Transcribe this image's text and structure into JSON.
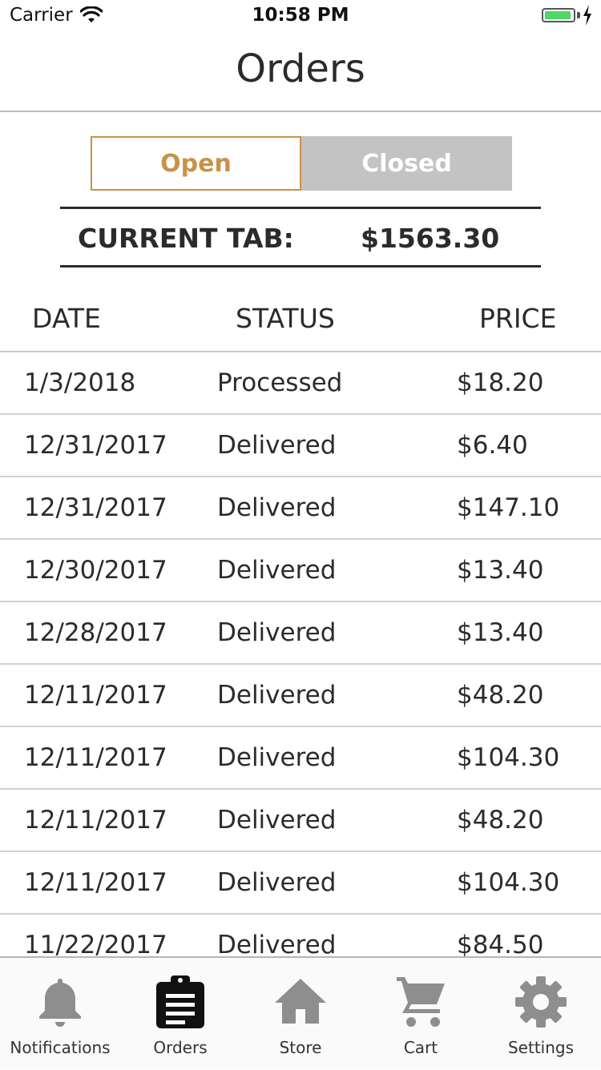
{
  "status_bar": {
    "carrier": "Carrier",
    "time": "10:58 PM",
    "battery_level": 0.95
  },
  "header": {
    "title": "Orders"
  },
  "segments": {
    "open": "Open",
    "closed": "Closed",
    "selected": "Open"
  },
  "current_tab": {
    "label": "CURRENT TAB:",
    "amount": "$1563.30"
  },
  "table": {
    "headers": {
      "date": "DATE",
      "status": "STATUS",
      "price": "PRICE"
    },
    "rows": [
      {
        "date": "1/3/2018",
        "status": "Processed",
        "price": "$18.20"
      },
      {
        "date": "12/31/2017",
        "status": "Delivered",
        "price": "$6.40"
      },
      {
        "date": "12/31/2017",
        "status": "Delivered",
        "price": "$147.10"
      },
      {
        "date": "12/30/2017",
        "status": "Delivered",
        "price": "$13.40"
      },
      {
        "date": "12/28/2017",
        "status": "Delivered",
        "price": "$13.40"
      },
      {
        "date": "12/11/2017",
        "status": "Delivered",
        "price": "$48.20"
      },
      {
        "date": "12/11/2017",
        "status": "Delivered",
        "price": "$104.30"
      },
      {
        "date": "12/11/2017",
        "status": "Delivered",
        "price": "$48.20"
      },
      {
        "date": "12/11/2017",
        "status": "Delivered",
        "price": "$104.30"
      },
      {
        "date": "11/22/2017",
        "status": "Delivered",
        "price": "$84.50"
      }
    ]
  },
  "tabbar": {
    "items": [
      {
        "label": "Notifications",
        "icon": "bell-icon"
      },
      {
        "label": "Orders",
        "icon": "clipboard-icon"
      },
      {
        "label": "Store",
        "icon": "home-icon"
      },
      {
        "label": "Cart",
        "icon": "cart-icon"
      },
      {
        "label": "Settings",
        "icon": "gear-icon"
      }
    ],
    "active": "Orders"
  },
  "colors": {
    "accent": "#c89249",
    "inactive_segment": "#c3c3c3",
    "icon_inactive": "#8e8e8e",
    "icon_active": "#111111",
    "battery": "#4cd964"
  }
}
